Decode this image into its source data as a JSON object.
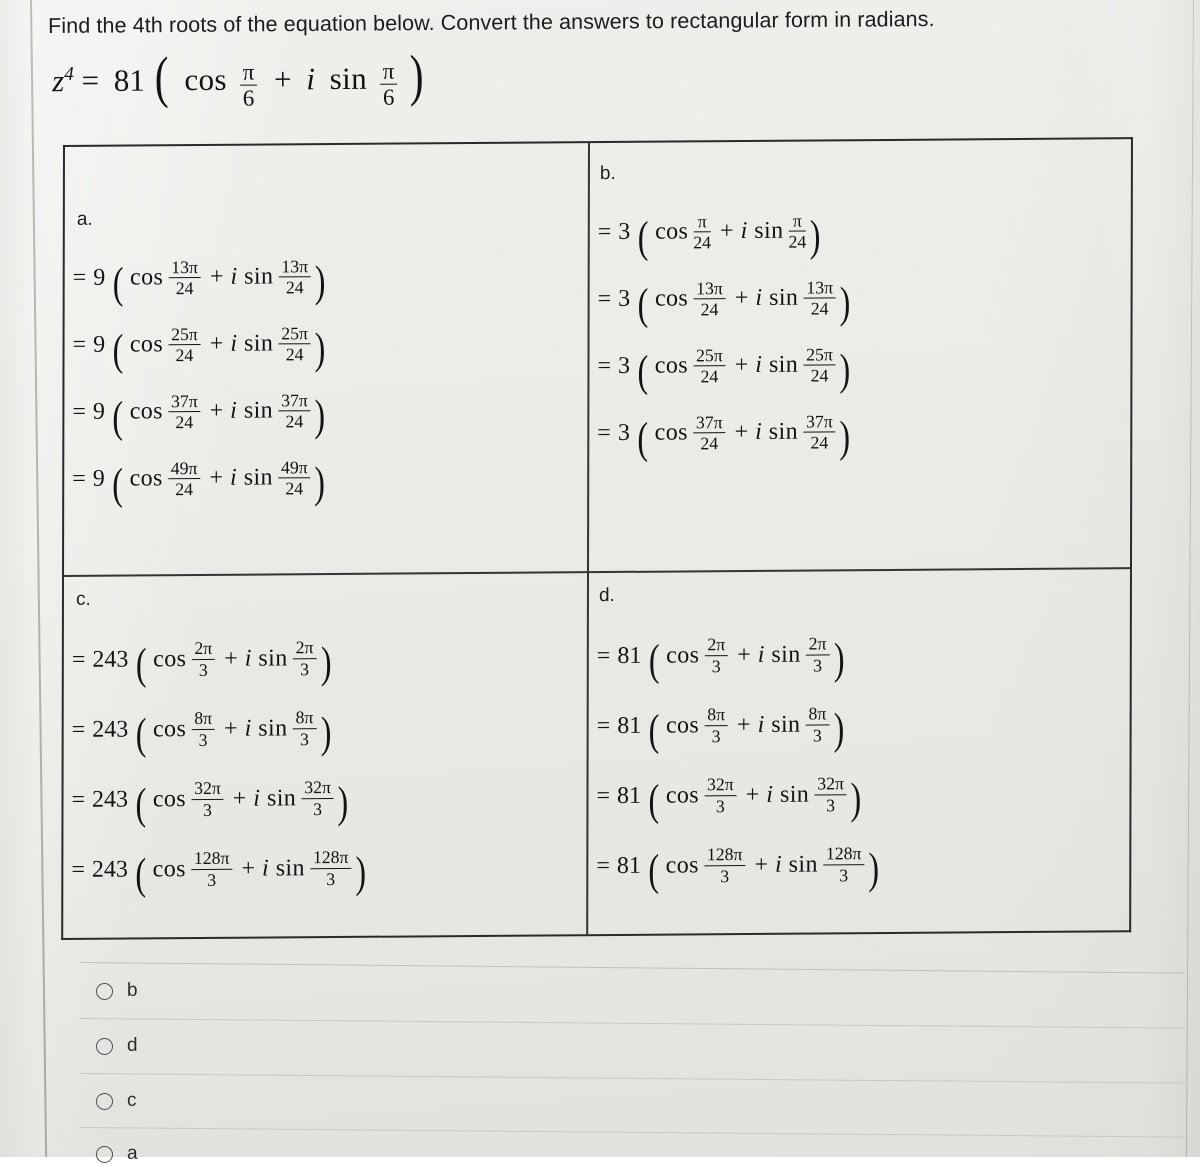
{
  "prompt": {
    "text": "Find the 4th roots of the equation below. Convert the answers to rectangular form in radians."
  },
  "equation": {
    "lhs_base": "z",
    "lhs_exponent": "4",
    "equals": "=",
    "modulus": "81",
    "open_paren": "(",
    "cos": "cos",
    "plus": "+",
    "i": "i",
    "sin": "sin",
    "angle_num": "π",
    "angle_den": "6",
    "close_paren": ")"
  },
  "symbols": {
    "equals": "=",
    "plus": "+",
    "i": "i",
    "cos": "cos",
    "sin": "sin",
    "open_paren": "(",
    "close_paren": ")"
  },
  "choices": [
    {
      "key": "a",
      "label": "a.",
      "coefficient": "9",
      "rows": [
        {
          "num": "13π",
          "den": "24"
        },
        {
          "num": "25π",
          "den": "24"
        },
        {
          "num": "37π",
          "den": "24"
        },
        {
          "num": "49π",
          "den": "24"
        }
      ]
    },
    {
      "key": "b",
      "label": "b.",
      "coefficient": "3",
      "rows": [
        {
          "num": "π",
          "den": "24"
        },
        {
          "num": "13π",
          "den": "24"
        },
        {
          "num": "25π",
          "den": "24"
        },
        {
          "num": "37π",
          "den": "24"
        }
      ]
    },
    {
      "key": "c",
      "label": "c.",
      "coefficient": "243",
      "rows": [
        {
          "num": "2π",
          "den": "3"
        },
        {
          "num": "8π",
          "den": "3"
        },
        {
          "num": "32π",
          "den": "3"
        },
        {
          "num": "128π",
          "den": "3"
        }
      ]
    },
    {
      "key": "d",
      "label": "d.",
      "coefficient": "81",
      "rows": [
        {
          "num": "2π",
          "den": "3"
        },
        {
          "num": "8π",
          "den": "3"
        },
        {
          "num": "32π",
          "den": "3"
        },
        {
          "num": "128π",
          "den": "3"
        }
      ]
    }
  ],
  "options": [
    {
      "label": "b",
      "selected": false
    },
    {
      "label": "d",
      "selected": false
    },
    {
      "label": "c",
      "selected": false
    },
    {
      "label": "a",
      "selected": false
    }
  ],
  "colors": {
    "paper": "#ecebe7",
    "ink": "#131313",
    "table_border": "#2a2a2a",
    "rule": "#c9c8c3"
  }
}
